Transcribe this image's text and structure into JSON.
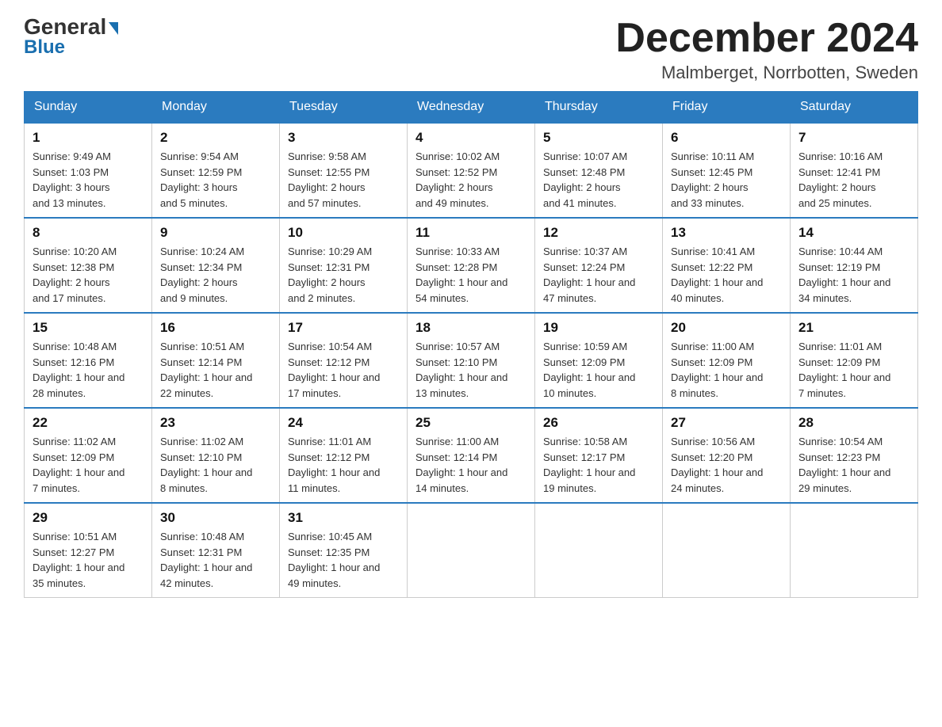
{
  "header": {
    "logo_line1": "General",
    "logo_line2": "Blue",
    "month_title": "December 2024",
    "location": "Malmberget, Norrbotten, Sweden"
  },
  "weekdays": [
    "Sunday",
    "Monday",
    "Tuesday",
    "Wednesday",
    "Thursday",
    "Friday",
    "Saturday"
  ],
  "weeks": [
    [
      {
        "day": "1",
        "info": "Sunrise: 9:49 AM\nSunset: 1:03 PM\nDaylight: 3 hours\nand 13 minutes."
      },
      {
        "day": "2",
        "info": "Sunrise: 9:54 AM\nSunset: 12:59 PM\nDaylight: 3 hours\nand 5 minutes."
      },
      {
        "day": "3",
        "info": "Sunrise: 9:58 AM\nSunset: 12:55 PM\nDaylight: 2 hours\nand 57 minutes."
      },
      {
        "day": "4",
        "info": "Sunrise: 10:02 AM\nSunset: 12:52 PM\nDaylight: 2 hours\nand 49 minutes."
      },
      {
        "day": "5",
        "info": "Sunrise: 10:07 AM\nSunset: 12:48 PM\nDaylight: 2 hours\nand 41 minutes."
      },
      {
        "day": "6",
        "info": "Sunrise: 10:11 AM\nSunset: 12:45 PM\nDaylight: 2 hours\nand 33 minutes."
      },
      {
        "day": "7",
        "info": "Sunrise: 10:16 AM\nSunset: 12:41 PM\nDaylight: 2 hours\nand 25 minutes."
      }
    ],
    [
      {
        "day": "8",
        "info": "Sunrise: 10:20 AM\nSunset: 12:38 PM\nDaylight: 2 hours\nand 17 minutes."
      },
      {
        "day": "9",
        "info": "Sunrise: 10:24 AM\nSunset: 12:34 PM\nDaylight: 2 hours\nand 9 minutes."
      },
      {
        "day": "10",
        "info": "Sunrise: 10:29 AM\nSunset: 12:31 PM\nDaylight: 2 hours\nand 2 minutes."
      },
      {
        "day": "11",
        "info": "Sunrise: 10:33 AM\nSunset: 12:28 PM\nDaylight: 1 hour and\n54 minutes."
      },
      {
        "day": "12",
        "info": "Sunrise: 10:37 AM\nSunset: 12:24 PM\nDaylight: 1 hour and\n47 minutes."
      },
      {
        "day": "13",
        "info": "Sunrise: 10:41 AM\nSunset: 12:22 PM\nDaylight: 1 hour and\n40 minutes."
      },
      {
        "day": "14",
        "info": "Sunrise: 10:44 AM\nSunset: 12:19 PM\nDaylight: 1 hour and\n34 minutes."
      }
    ],
    [
      {
        "day": "15",
        "info": "Sunrise: 10:48 AM\nSunset: 12:16 PM\nDaylight: 1 hour and\n28 minutes."
      },
      {
        "day": "16",
        "info": "Sunrise: 10:51 AM\nSunset: 12:14 PM\nDaylight: 1 hour and\n22 minutes."
      },
      {
        "day": "17",
        "info": "Sunrise: 10:54 AM\nSunset: 12:12 PM\nDaylight: 1 hour and\n17 minutes."
      },
      {
        "day": "18",
        "info": "Sunrise: 10:57 AM\nSunset: 12:10 PM\nDaylight: 1 hour and\n13 minutes."
      },
      {
        "day": "19",
        "info": "Sunrise: 10:59 AM\nSunset: 12:09 PM\nDaylight: 1 hour and\n10 minutes."
      },
      {
        "day": "20",
        "info": "Sunrise: 11:00 AM\nSunset: 12:09 PM\nDaylight: 1 hour and\n8 minutes."
      },
      {
        "day": "21",
        "info": "Sunrise: 11:01 AM\nSunset: 12:09 PM\nDaylight: 1 hour and\n7 minutes."
      }
    ],
    [
      {
        "day": "22",
        "info": "Sunrise: 11:02 AM\nSunset: 12:09 PM\nDaylight: 1 hour and\n7 minutes."
      },
      {
        "day": "23",
        "info": "Sunrise: 11:02 AM\nSunset: 12:10 PM\nDaylight: 1 hour and\n8 minutes."
      },
      {
        "day": "24",
        "info": "Sunrise: 11:01 AM\nSunset: 12:12 PM\nDaylight: 1 hour and\n11 minutes."
      },
      {
        "day": "25",
        "info": "Sunrise: 11:00 AM\nSunset: 12:14 PM\nDaylight: 1 hour and\n14 minutes."
      },
      {
        "day": "26",
        "info": "Sunrise: 10:58 AM\nSunset: 12:17 PM\nDaylight: 1 hour and\n19 minutes."
      },
      {
        "day": "27",
        "info": "Sunrise: 10:56 AM\nSunset: 12:20 PM\nDaylight: 1 hour and\n24 minutes."
      },
      {
        "day": "28",
        "info": "Sunrise: 10:54 AM\nSunset: 12:23 PM\nDaylight: 1 hour and\n29 minutes."
      }
    ],
    [
      {
        "day": "29",
        "info": "Sunrise: 10:51 AM\nSunset: 12:27 PM\nDaylight: 1 hour and\n35 minutes."
      },
      {
        "day": "30",
        "info": "Sunrise: 10:48 AM\nSunset: 12:31 PM\nDaylight: 1 hour and\n42 minutes."
      },
      {
        "day": "31",
        "info": "Sunrise: 10:45 AM\nSunset: 12:35 PM\nDaylight: 1 hour and\n49 minutes."
      },
      null,
      null,
      null,
      null
    ]
  ]
}
